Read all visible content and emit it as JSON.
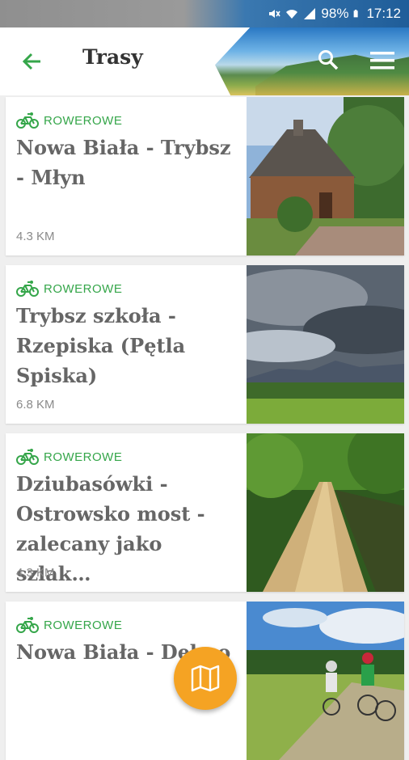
{
  "status_bar": {
    "battery": "98%",
    "time": "17:12"
  },
  "header": {
    "title": "Trasy"
  },
  "routes": [
    {
      "category": "ROWEROWE",
      "name": "Nowa Biała - Trybsz - Młyn",
      "distance": "4.3 KM",
      "photo": "wooden-church"
    },
    {
      "category": "ROWEROWE",
      "name": "Trybsz szkoła - Rzepiska (Pętla Spiska)",
      "distance": "6.8 KM",
      "photo": "mountain-clouds"
    },
    {
      "category": "ROWEROWE",
      "name": "Dziubasówki - Ostrowsko most - zalecany jako szlak…",
      "distance": "4.3 KM",
      "photo": "forest-path"
    },
    {
      "category": "ROWEROWE",
      "name": "Nowa Biała - Dębno",
      "distance": "",
      "photo": "cyclists"
    }
  ],
  "colors": {
    "accent_green": "#35a64a",
    "fab_orange": "#f5a323"
  }
}
